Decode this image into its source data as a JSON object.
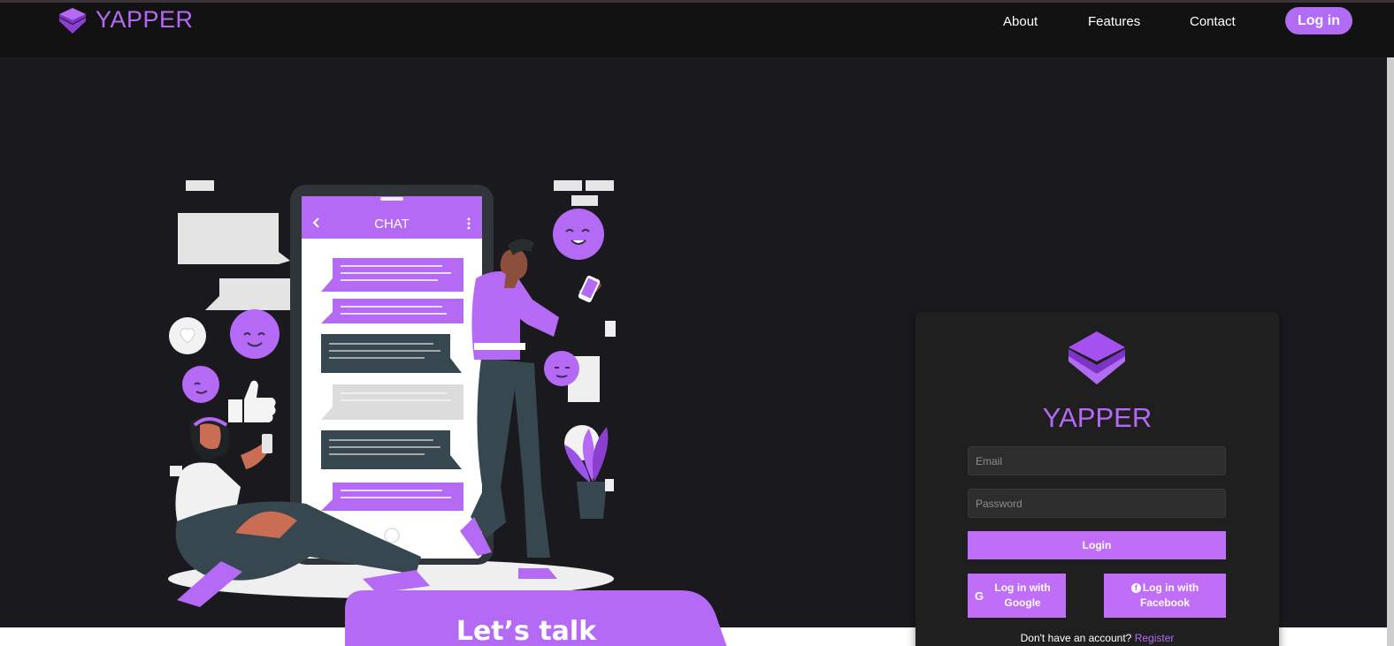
{
  "brand": {
    "name": "YAPPER",
    "logo_icon": "stacked-layers-icon"
  },
  "nav": {
    "about": "About",
    "features": "Features",
    "contact": "Contact",
    "login": "Log in"
  },
  "hero": {
    "phone_header": "CHAT",
    "banner": "Let’s talk"
  },
  "login_card": {
    "title": "YAPPER",
    "email_placeholder": "Email",
    "password_placeholder": "Password",
    "login_button": "Login",
    "google_button": "Log in with Google",
    "facebook_button": "Log in with Facebook",
    "register_prompt": "Don't have an account?",
    "register_link": "Register"
  },
  "colors": {
    "accent": "#b46af5",
    "button": "#c06ef8",
    "background": "#1a191e",
    "navbar": "#121212",
    "card": "#1f1f1f"
  }
}
